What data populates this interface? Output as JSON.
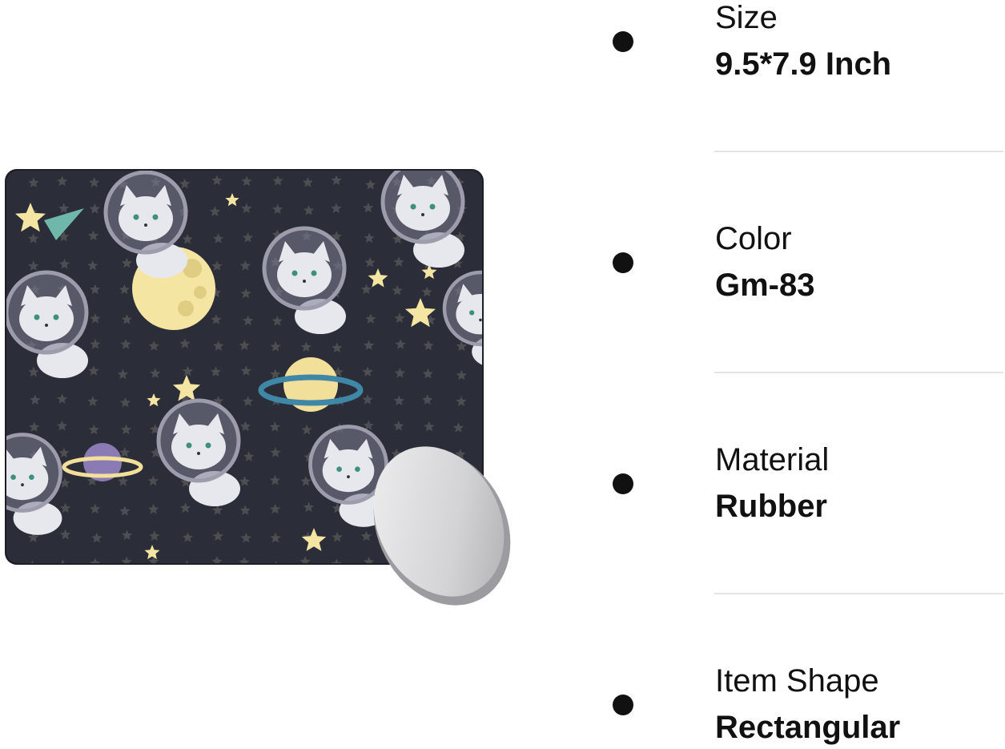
{
  "product": {
    "image_name": "space-cats-mouse-pad",
    "colors": {
      "pad_background": "#2b2d38",
      "star_dim": "#4d4e52",
      "star_bright": "#f4e6a2",
      "cat": "#e6e8ee",
      "helmet": "#7c7b8f",
      "moon": "#f4e6a2",
      "planet_yellow": "#f2df9a",
      "ring_blue": "#3f87a6",
      "planet_purple": "#8a7bb5",
      "mouse": "#d8d8da"
    }
  },
  "specs": [
    {
      "label": "Size",
      "value": "9.5*7.9 Inch"
    },
    {
      "label": "Color",
      "value": "Gm-83"
    },
    {
      "label": "Material",
      "value": "Rubber"
    },
    {
      "label": "Item Shape",
      "value": "Rectangular"
    }
  ]
}
